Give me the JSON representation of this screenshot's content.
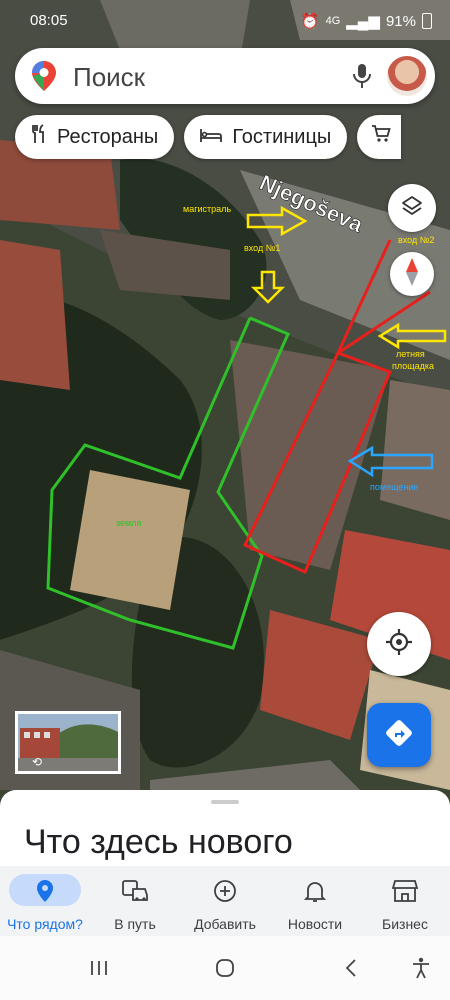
{
  "status_bar": {
    "time": "08:05",
    "battery": "91%",
    "network": "4G"
  },
  "search": {
    "placeholder": "Поиск"
  },
  "chips": [
    {
      "label": "Рестораны",
      "icon": "fork-knife-icon"
    },
    {
      "label": "Гостиницы",
      "icon": "bed-icon"
    },
    {
      "label": "",
      "icon": "cart-icon"
    }
  ],
  "map": {
    "street_name": "Njegoševa",
    "annotations": {
      "highway": "магистраль",
      "entrance1": "вход №1",
      "entrance2": "вход №2",
      "summer_terrace_line1": "летняя",
      "summer_terrace_line2": "площадка",
      "premises": "помещение",
      "land": "земля"
    },
    "annotation_colors": {
      "yellow": "#ffe600",
      "blue": "#2aa6ff",
      "red": "#e8201c",
      "green": "#2fc02a"
    }
  },
  "bottom_sheet": {
    "title": "Что здесь нового"
  },
  "bottom_nav": [
    {
      "label": "Что рядом?",
      "icon": "location-pin-icon",
      "active": true
    },
    {
      "label": "В путь",
      "icon": "commute-icon",
      "active": false
    },
    {
      "label": "Добавить",
      "icon": "add-circle-icon",
      "active": false
    },
    {
      "label": "Новости",
      "icon": "bell-icon",
      "active": false
    },
    {
      "label": "Бизнес",
      "icon": "storefront-icon",
      "active": false
    }
  ],
  "colors": {
    "accent": "#1a73e8",
    "active_pill": "#c6dafc"
  }
}
